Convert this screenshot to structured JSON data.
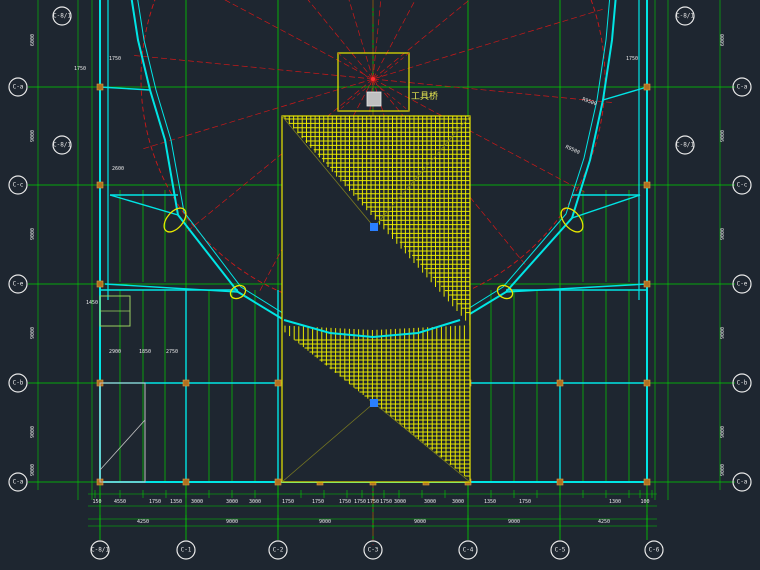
{
  "drawing": {
    "label_tool": "工具桥",
    "bottom_axes": [
      "C-8/1",
      "C-1",
      "C-2",
      "C-3",
      "C-4",
      "C-5",
      "C-6"
    ],
    "left_axes": [
      "C-8/1",
      "C-a",
      "C-c",
      "C-e",
      "C-b",
      "C-a"
    ],
    "right_axes": [
      "C-8/1",
      "C-a",
      "C-c",
      "C-e",
      "C-b",
      "C-a"
    ],
    "corner_axes": [
      "C-8/1",
      "C-8/1",
      "C-8/1",
      "C-8/1"
    ],
    "dims_bottom_row1": [
      "150",
      "4550",
      "1750",
      "1350",
      "3000",
      "3000",
      "3000",
      "1750",
      "1750",
      "1750",
      "1750",
      "1750",
      "1750",
      "3000",
      "3000",
      "3000",
      "1350",
      "1750",
      "1300",
      "100"
    ],
    "dims_bottom_row2": [
      "4250",
      "9000",
      "9000",
      "9000",
      "9000",
      "4250"
    ],
    "dims_left": [
      "6000",
      "9000",
      "9000",
      "9000",
      "9000",
      "9000"
    ],
    "dims_right": [
      "6000",
      "9000",
      "9000",
      "9000",
      "9000",
      "9000"
    ],
    "dims_small": [
      "2900",
      "1850",
      "2750",
      "1750",
      "1750",
      "1450",
      "1750",
      "2600"
    ],
    "radius_labels": [
      "R9500",
      "R9500"
    ],
    "colors": {
      "background": "#1e2630",
      "wall": "#00e5e5",
      "grid": "#00d000",
      "axis_red": "#d01818",
      "scaffold": "#e8e800",
      "text": "#e8e8e8",
      "marker": "#2a7fff"
    }
  }
}
